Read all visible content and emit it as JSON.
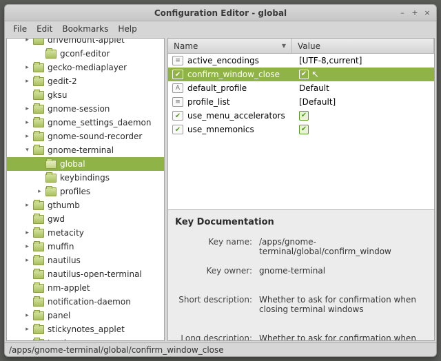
{
  "window": {
    "title": "Configuration Editor - global"
  },
  "menu": {
    "file": "File",
    "edit": "Edit",
    "bookmarks": "Bookmarks",
    "help": "Help"
  },
  "tree": {
    "items": [
      {
        "label": "drivemount-applet",
        "depth": 1,
        "expander": "collapsed",
        "cut": true
      },
      {
        "label": "gconf-editor",
        "depth": 2,
        "expander": "none"
      },
      {
        "label": "gecko-mediaplayer",
        "depth": 1,
        "expander": "collapsed"
      },
      {
        "label": "gedit-2",
        "depth": 1,
        "expander": "collapsed"
      },
      {
        "label": "gksu",
        "depth": 1,
        "expander": "none"
      },
      {
        "label": "gnome-session",
        "depth": 1,
        "expander": "collapsed"
      },
      {
        "label": "gnome_settings_daemon",
        "depth": 1,
        "expander": "collapsed"
      },
      {
        "label": "gnome-sound-recorder",
        "depth": 1,
        "expander": "collapsed"
      },
      {
        "label": "gnome-terminal",
        "depth": 1,
        "expander": "expanded"
      },
      {
        "label": "global",
        "depth": 2,
        "expander": "none",
        "selected": true,
        "open": true
      },
      {
        "label": "keybindings",
        "depth": 2,
        "expander": "none"
      },
      {
        "label": "profiles",
        "depth": 2,
        "expander": "collapsed"
      },
      {
        "label": "gthumb",
        "depth": 1,
        "expander": "collapsed"
      },
      {
        "label": "gwd",
        "depth": 1,
        "expander": "none"
      },
      {
        "label": "metacity",
        "depth": 1,
        "expander": "collapsed"
      },
      {
        "label": "muffin",
        "depth": 1,
        "expander": "collapsed"
      },
      {
        "label": "nautilus",
        "depth": 1,
        "expander": "collapsed"
      },
      {
        "label": "nautilus-open-terminal",
        "depth": 1,
        "expander": "none"
      },
      {
        "label": "nm-applet",
        "depth": 1,
        "expander": "none"
      },
      {
        "label": "notification-daemon",
        "depth": 1,
        "expander": "none"
      },
      {
        "label": "panel",
        "depth": 1,
        "expander": "collapsed"
      },
      {
        "label": "stickynotes_applet",
        "depth": 1,
        "expander": "collapsed"
      },
      {
        "label": "tomboy",
        "depth": 1,
        "expander": "collapsed"
      }
    ]
  },
  "list": {
    "columns": {
      "name": "Name",
      "value": "Value"
    },
    "rows": [
      {
        "icon": "list",
        "name": "active_encodings",
        "value_text": "[UTF-8,current]"
      },
      {
        "icon": "check",
        "name": "confirm_window_close",
        "value_bool": true,
        "selected": true
      },
      {
        "icon": "text",
        "name": "default_profile",
        "value_text": "Default"
      },
      {
        "icon": "list",
        "name": "profile_list",
        "value_text": "[Default]"
      },
      {
        "icon": "check",
        "name": "use_menu_accelerators",
        "value_bool": true
      },
      {
        "icon": "check",
        "name": "use_mnemonics",
        "value_bool": true
      }
    ]
  },
  "doc": {
    "heading": "Key Documentation",
    "labels": {
      "key_name": "Key name:",
      "key_owner": "Key owner:",
      "short_desc": "Short description:",
      "long_desc": "Long description:"
    },
    "values": {
      "key_name": "/apps/gnome-terminal/global/confirm_window",
      "key_owner": "gnome-terminal",
      "short_desc": "Whether to ask for confirmation when closing terminal windows",
      "long_desc": "Whether to ask for confirmation when closing"
    }
  },
  "statusbar": {
    "path": "/apps/gnome-terminal/global/confirm_window_close"
  }
}
